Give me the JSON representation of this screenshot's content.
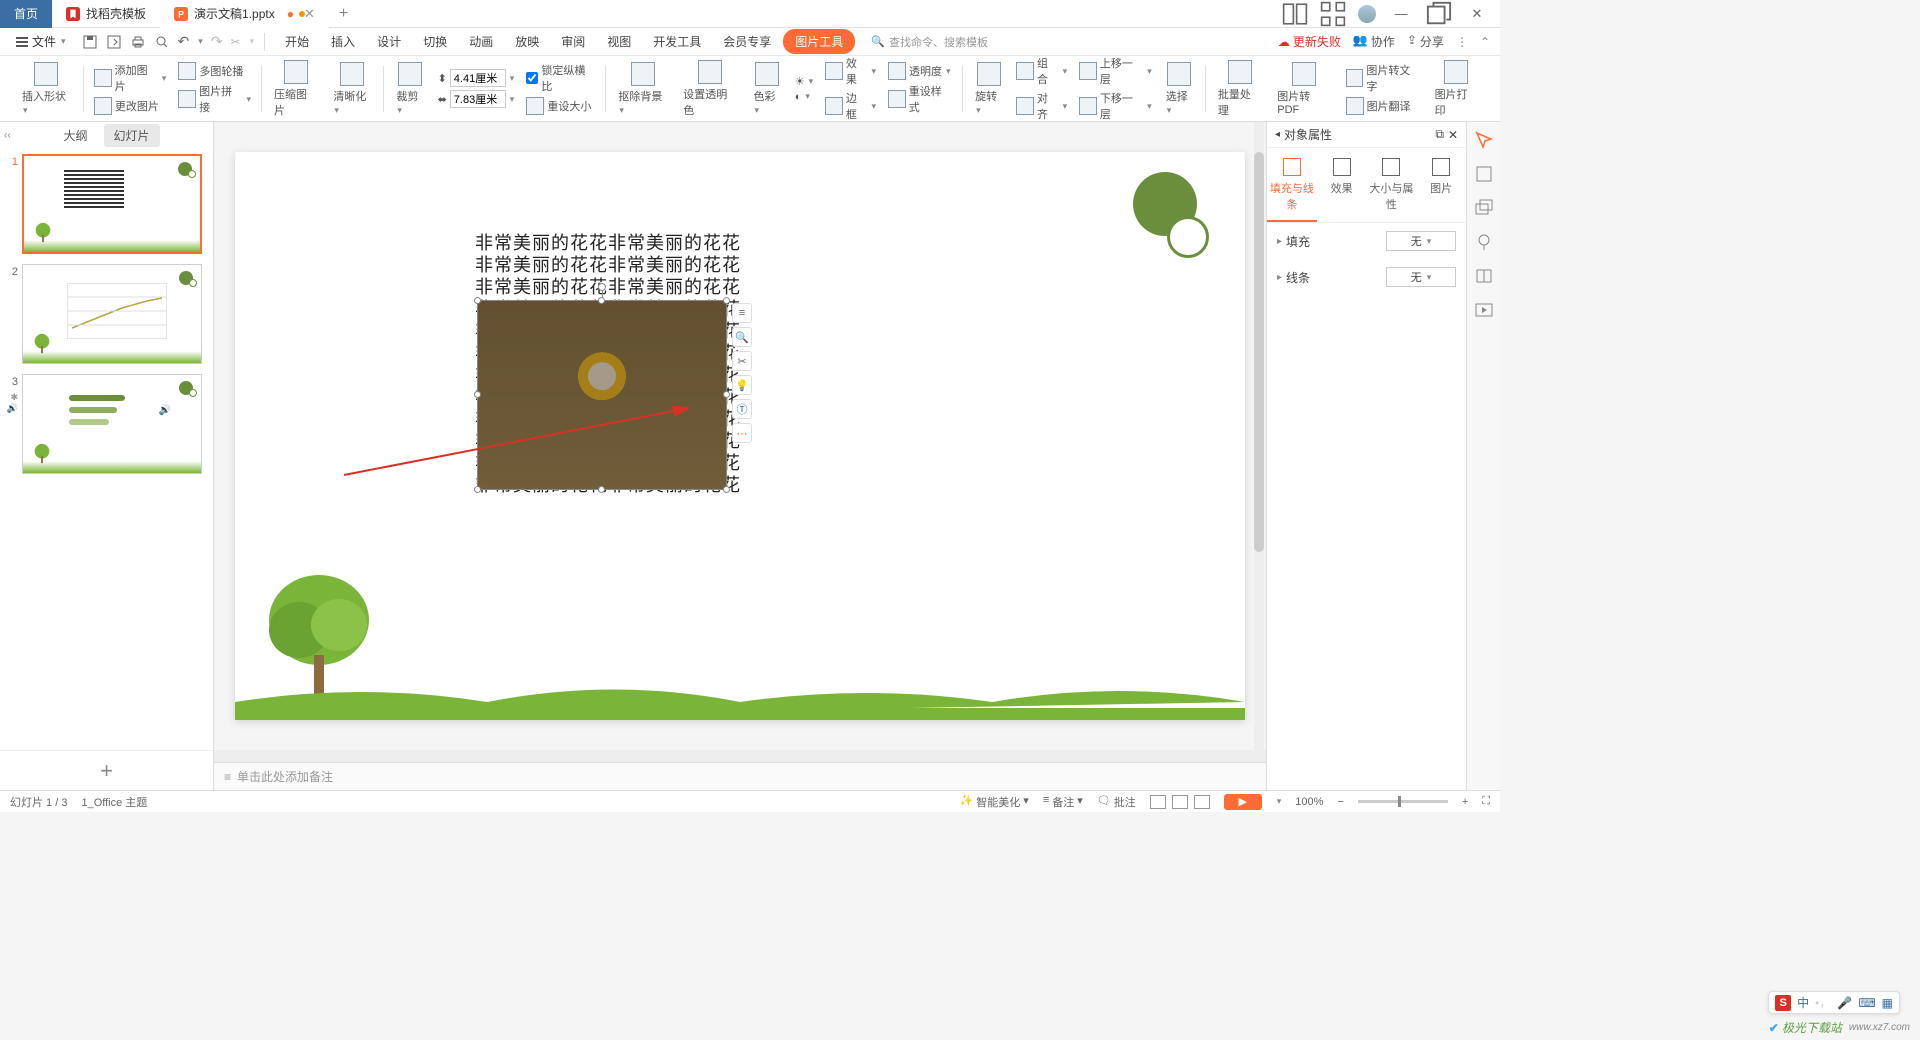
{
  "titlebar": {
    "home": "首页",
    "tab1": "找稻壳模板",
    "tab2": "演示文稿1.pptx"
  },
  "menubar": {
    "file": "文件",
    "menus": [
      "开始",
      "插入",
      "设计",
      "切换",
      "动画",
      "放映",
      "审阅",
      "视图",
      "开发工具",
      "会员专享",
      "图片工具"
    ],
    "search_placeholder": "查找命令、搜索模板",
    "update_fail": "更新失败",
    "collab": "协作",
    "share": "分享"
  },
  "ribbon": {
    "insert_shape": "插入形状",
    "add_image": "添加图片",
    "change_image": "更改图片",
    "multi_rotate": "多图轮播",
    "image_join": "图片拼接",
    "compress": "压缩图片",
    "clarity": "清晰化",
    "crop": "裁剪",
    "width": "4.41厘米",
    "height": "7.83厘米",
    "lock_ratio": "锁定纵横比",
    "reset_size": "重设大小",
    "remove_bg": "抠除背景",
    "set_transparent": "设置透明色",
    "color": "色彩",
    "effect": "效果",
    "transparency": "透明度",
    "border": "边框",
    "reset_style": "重设样式",
    "rotate": "旋转",
    "combine": "组合",
    "align": "对齐",
    "up_layer": "上移一层",
    "down_layer": "下移一层",
    "select": "选择",
    "batch": "批量处理",
    "to_pdf": "图片转PDF",
    "to_text": "图片转文字",
    "translate": "图片翻译",
    "print": "图片打印"
  },
  "outline": {
    "tab_outline": "大纲",
    "tab_slides": "幻灯片"
  },
  "slide": {
    "text_line": "非常美丽的花花非常美丽的花花"
  },
  "notes": {
    "placeholder": "单击此处添加备注"
  },
  "rightpane": {
    "title": "对象属性",
    "tab_fill": "填充与线条",
    "tab_effect": "效果",
    "tab_size": "大小与属性",
    "tab_image": "图片",
    "fill": "填充",
    "line": "线条",
    "none": "无"
  },
  "status": {
    "slide_info": "幻灯片 1 / 3",
    "theme": "1_Office 主题",
    "beautify": "智能美化",
    "notes": "备注",
    "comments": "批注",
    "zoom": "100%"
  },
  "ime": {
    "mode": "中"
  },
  "watermark": {
    "text": "极光下载站",
    "url": "www.xz7.com"
  }
}
